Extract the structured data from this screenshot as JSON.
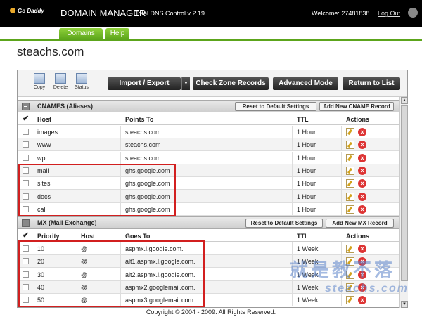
{
  "header": {
    "logo_text": "Go Daddy",
    "app_title": "DOMAIN MANAGER",
    "app_subtitle": "Total DNS Control v 2.19",
    "welcome": "Welcome: 27481838",
    "logout": "Log Out"
  },
  "tabs": [
    {
      "label": "Domains"
    },
    {
      "label": "Help"
    }
  ],
  "domain_title": "steachs.com",
  "toolbar": {
    "copy": "Copy",
    "delete": "Delete",
    "status": "Status",
    "import_export": "Import / Export",
    "check_zone": "Check Zone Records",
    "advanced": "Advanced Mode",
    "return_list": "Return to List"
  },
  "cname": {
    "title": "CNAMES (Aliases)",
    "reset": "Reset to Default Settings",
    "add": "Add New CNAME Record",
    "columns": [
      "Host",
      "Points To",
      "TTL",
      "Actions"
    ],
    "rows": [
      {
        "host": "images",
        "points_to": "steachs.com",
        "ttl": "1 Hour"
      },
      {
        "host": "www",
        "points_to": "steachs.com",
        "ttl": "1 Hour"
      },
      {
        "host": "wp",
        "points_to": "steachs.com",
        "ttl": "1 Hour"
      },
      {
        "host": "mail",
        "points_to": "ghs.google.com",
        "ttl": "1 Hour"
      },
      {
        "host": "sites",
        "points_to": "ghs.google.com",
        "ttl": "1 Hour"
      },
      {
        "host": "docs",
        "points_to": "ghs.google.com",
        "ttl": "1 Hour"
      },
      {
        "host": "cal",
        "points_to": "ghs.google.com",
        "ttl": "1 Hour"
      }
    ]
  },
  "mx": {
    "title": "MX (Mail Exchange)",
    "reset": "Reset to Default Settings",
    "add": "Add New MX Record",
    "columns": [
      "Priority",
      "Host",
      "Goes To",
      "TTL",
      "Actions"
    ],
    "rows": [
      {
        "priority": "10",
        "host": "@",
        "goes_to": "aspmx.l.google.com.",
        "ttl": "1 Week"
      },
      {
        "priority": "20",
        "host": "@",
        "goes_to": "alt1.aspmx.l.google.com.",
        "ttl": "1 Week"
      },
      {
        "priority": "30",
        "host": "@",
        "goes_to": "alt2.aspmx.l.google.com.",
        "ttl": "1 Week"
      },
      {
        "priority": "40",
        "host": "@",
        "goes_to": "aspmx2.googlemail.com.",
        "ttl": "1 Week"
      },
      {
        "priority": "50",
        "host": "@",
        "goes_to": "aspmx3.googlemail.com.",
        "ttl": "1 Week"
      }
    ]
  },
  "footer": "Copyright © 2004 - 2009. All Rights Reserved.",
  "watermark": {
    "line1": "就是教不落",
    "line2": "steachs.com"
  },
  "colors": {
    "accent_green": "#5ca51b",
    "highlight_red": "#d21f1f"
  }
}
